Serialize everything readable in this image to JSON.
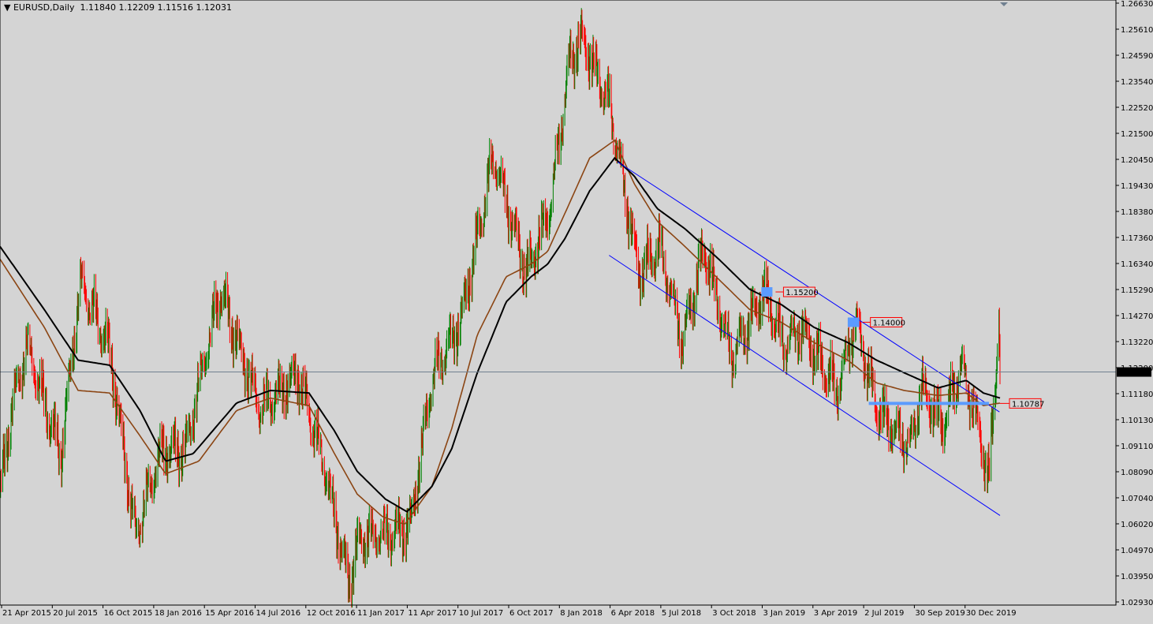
{
  "header": {
    "symbol": "EURUSD",
    "timeframe": "Daily",
    "open": "1.11840",
    "high": "1.12209",
    "low": "1.11516",
    "close": "1.12031"
  },
  "colors": {
    "background": "#d4d4d4",
    "bull_candle": "#008000",
    "bear_candle": "#ff0000",
    "ma_fast": "#8b4513",
    "ma_slow": "#000000",
    "channel": "#0000ff",
    "zone": "#5b9bff",
    "label_border": "#ff0000",
    "current_price_line": "#708090"
  },
  "chart_data": {
    "type": "candlestick",
    "symbol": "EURUSD",
    "timeframe": "Daily",
    "ylim": [
      1.0293,
      1.2663
    ],
    "y_ticks": [
      "1.26630",
      "1.25610",
      "1.24590",
      "1.23540",
      "1.22520",
      "1.21500",
      "1.20450",
      "1.19430",
      "1.18380",
      "1.17360",
      "1.16340",
      "1.15290",
      "1.14270",
      "1.13220",
      "1.12200",
      "1.11180",
      "1.10130",
      "1.09110",
      "1.08090",
      "1.07040",
      "1.06020",
      "1.04970",
      "1.03950",
      "1.02930"
    ],
    "x_ticks": [
      "21 Apr 2015",
      "20 Jul 2015",
      "16 Oct 2015",
      "18 Jan 2016",
      "15 Apr 2016",
      "14 Jul 2016",
      "12 Oct 2016",
      "11 Jan 2017",
      "11 Apr 2017",
      "10 Jul 2017",
      "6 Oct 2017",
      "8 Jan 2018",
      "6 Apr 2018",
      "5 Jul 2018",
      "3 Oct 2018",
      "3 Jan 2019",
      "3 Apr 2019",
      "2 Jul 2019",
      "30 Sep 2019",
      "30 Dec 2019"
    ],
    "x_range": [
      "2015-04-01",
      "2020-03-11"
    ],
    "current_price": 1.12031,
    "close_anchors": [
      [
        "2015-04-01",
        1.072
      ],
      [
        "2015-04-21",
        1.105
      ],
      [
        "2015-05-20",
        1.13
      ],
      [
        "2015-07-20",
        1.088
      ],
      [
        "2015-08-24",
        1.155
      ],
      [
        "2015-10-16",
        1.13
      ],
      [
        "2015-12-02",
        1.055
      ],
      [
        "2016-01-18",
        1.09
      ],
      [
        "2016-03-01",
        1.09
      ],
      [
        "2016-05-03",
        1.153
      ],
      [
        "2016-07-14",
        1.105
      ],
      [
        "2016-09-20",
        1.12
      ],
      [
        "2016-11-09",
        1.08
      ],
      [
        "2016-12-20",
        1.038
      ],
      [
        "2017-01-11",
        1.055
      ],
      [
        "2017-02-22",
        1.055
      ],
      [
        "2017-04-11",
        1.06
      ],
      [
        "2017-05-20",
        1.117
      ],
      [
        "2017-07-10",
        1.14
      ],
      [
        "2017-09-08",
        1.205
      ],
      [
        "2017-11-07",
        1.16
      ],
      [
        "2017-12-20",
        1.185
      ],
      [
        "2018-01-25",
        1.245
      ],
      [
        "2018-02-16",
        1.253
      ],
      [
        "2018-04-06",
        1.225
      ],
      [
        "2018-05-29",
        1.16
      ],
      [
        "2018-07-05",
        1.17
      ],
      [
        "2018-08-15",
        1.132
      ],
      [
        "2018-09-24",
        1.17
      ],
      [
        "2018-11-12",
        1.125
      ],
      [
        "2019-01-10",
        1.153
      ],
      [
        "2019-02-15",
        1.13
      ],
      [
        "2019-03-20",
        1.137
      ],
      [
        "2019-05-23",
        1.113
      ],
      [
        "2019-06-25",
        1.14
      ],
      [
        "2019-08-01",
        1.107
      ],
      [
        "2019-09-03",
        1.097
      ],
      [
        "2019-10-01",
        1.09
      ],
      [
        "2019-10-21",
        1.114
      ],
      [
        "2019-11-29",
        1.1
      ],
      [
        "2019-12-31",
        1.122
      ],
      [
        "2020-01-28",
        1.102
      ],
      [
        "2020-02-20",
        1.078
      ],
      [
        "2020-03-02",
        1.115
      ],
      [
        "2020-03-09",
        1.147
      ],
      [
        "2020-03-11",
        1.1203
      ]
    ],
    "moving_averages": [
      {
        "style": "fast (brown)",
        "anchors": [
          [
            "2015-04-01",
            1.165
          ],
          [
            "2015-06-20",
            1.138
          ],
          [
            "2015-08-20",
            1.113
          ],
          [
            "2015-10-16",
            1.112
          ],
          [
            "2015-12-10",
            1.095
          ],
          [
            "2016-01-25",
            1.08
          ],
          [
            "2016-03-25",
            1.085
          ],
          [
            "2016-06-01",
            1.105
          ],
          [
            "2016-08-01",
            1.11
          ],
          [
            "2016-10-10",
            1.107
          ],
          [
            "2016-11-25",
            1.088
          ],
          [
            "2017-01-05",
            1.072
          ],
          [
            "2017-02-20",
            1.063
          ],
          [
            "2017-04-01",
            1.06
          ],
          [
            "2017-05-20",
            1.075
          ],
          [
            "2017-06-25",
            1.098
          ],
          [
            "2017-08-10",
            1.135
          ],
          [
            "2017-10-01",
            1.158
          ],
          [
            "2017-11-15",
            1.163
          ],
          [
            "2017-12-15",
            1.168
          ],
          [
            "2018-01-15",
            1.183
          ],
          [
            "2018-03-01",
            1.205
          ],
          [
            "2018-04-15",
            1.212
          ],
          [
            "2018-05-20",
            1.195
          ],
          [
            "2018-07-01",
            1.18
          ],
          [
            "2018-08-20",
            1.17
          ],
          [
            "2018-10-20",
            1.157
          ],
          [
            "2018-12-15",
            1.145
          ],
          [
            "2019-02-10",
            1.14
          ],
          [
            "2019-04-10",
            1.132
          ],
          [
            "2019-06-10",
            1.125
          ],
          [
            "2019-08-01",
            1.116
          ],
          [
            "2019-09-20",
            1.113
          ],
          [
            "2019-11-20",
            1.111
          ],
          [
            "2020-01-10",
            1.112
          ],
          [
            "2020-02-10",
            1.107
          ],
          [
            "2020-03-11",
            1.108
          ]
        ]
      },
      {
        "style": "slow (black)",
        "anchors": [
          [
            "2015-04-01",
            1.17
          ],
          [
            "2015-06-20",
            1.145
          ],
          [
            "2015-08-20",
            1.125
          ],
          [
            "2015-10-16",
            1.123
          ],
          [
            "2015-12-10",
            1.105
          ],
          [
            "2016-01-25",
            1.085
          ],
          [
            "2016-03-15",
            1.088
          ],
          [
            "2016-06-01",
            1.108
          ],
          [
            "2016-08-01",
            1.113
          ],
          [
            "2016-10-10",
            1.112
          ],
          [
            "2016-11-25",
            1.097
          ],
          [
            "2017-01-05",
            1.081
          ],
          [
            "2017-02-25",
            1.07
          ],
          [
            "2017-04-05",
            1.065
          ],
          [
            "2017-05-20",
            1.075
          ],
          [
            "2017-06-25",
            1.09
          ],
          [
            "2017-08-10",
            1.12
          ],
          [
            "2017-10-01",
            1.148
          ],
          [
            "2017-11-15",
            1.158
          ],
          [
            "2017-12-15",
            1.163
          ],
          [
            "2018-01-15",
            1.173
          ],
          [
            "2018-03-01",
            1.192
          ],
          [
            "2018-04-15",
            1.205
          ],
          [
            "2018-05-20",
            1.198
          ],
          [
            "2018-07-01",
            1.185
          ],
          [
            "2018-08-20",
            1.177
          ],
          [
            "2018-10-20",
            1.165
          ],
          [
            "2018-12-15",
            1.153
          ],
          [
            "2019-02-10",
            1.147
          ],
          [
            "2019-04-10",
            1.138
          ],
          [
            "2019-06-10",
            1.132
          ],
          [
            "2019-08-01",
            1.125
          ],
          [
            "2019-09-20",
            1.12
          ],
          [
            "2019-11-20",
            1.114
          ],
          [
            "2020-01-10",
            1.117
          ],
          [
            "2020-02-10",
            1.112
          ],
          [
            "2020-03-11",
            1.11
          ]
        ]
      }
    ],
    "trend_channel": [
      {
        "from": [
          "2018-04-20",
          1.2035
        ],
        "to": [
          "2020-03-10",
          1.1045
        ]
      },
      {
        "from": [
          "2018-04-05",
          1.1665
        ],
        "to": [
          "2020-03-11",
          1.0635
        ]
      }
    ],
    "levels": [
      {
        "label": "1.15200",
        "price": 1.152,
        "zone_from": "2019-01-05",
        "zone_to": "2019-01-25"
      },
      {
        "label": "1.14000",
        "price": 1.14,
        "zone_from": "2019-06-10",
        "zone_to": "2019-07-01"
      },
      {
        "label": "1.10787",
        "price": 1.10787,
        "zone_from": "2019-07-18",
        "zone_to": "2020-02-20"
      }
    ]
  }
}
